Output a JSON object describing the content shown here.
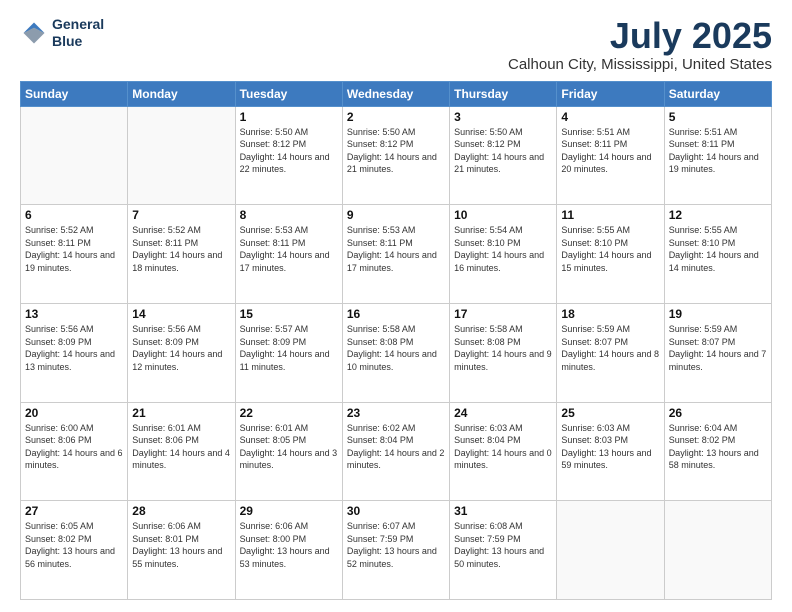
{
  "header": {
    "logo_line1": "General",
    "logo_line2": "Blue",
    "title": "July 2025",
    "subtitle": "Calhoun City, Mississippi, United States"
  },
  "weekdays": [
    "Sunday",
    "Monday",
    "Tuesday",
    "Wednesday",
    "Thursday",
    "Friday",
    "Saturday"
  ],
  "weeks": [
    [
      {
        "day": "",
        "info": ""
      },
      {
        "day": "",
        "info": ""
      },
      {
        "day": "1",
        "info": "Sunrise: 5:50 AM\nSunset: 8:12 PM\nDaylight: 14 hours\nand 22 minutes."
      },
      {
        "day": "2",
        "info": "Sunrise: 5:50 AM\nSunset: 8:12 PM\nDaylight: 14 hours\nand 21 minutes."
      },
      {
        "day": "3",
        "info": "Sunrise: 5:50 AM\nSunset: 8:12 PM\nDaylight: 14 hours\nand 21 minutes."
      },
      {
        "day": "4",
        "info": "Sunrise: 5:51 AM\nSunset: 8:11 PM\nDaylight: 14 hours\nand 20 minutes."
      },
      {
        "day": "5",
        "info": "Sunrise: 5:51 AM\nSunset: 8:11 PM\nDaylight: 14 hours\nand 19 minutes."
      }
    ],
    [
      {
        "day": "6",
        "info": "Sunrise: 5:52 AM\nSunset: 8:11 PM\nDaylight: 14 hours\nand 19 minutes."
      },
      {
        "day": "7",
        "info": "Sunrise: 5:52 AM\nSunset: 8:11 PM\nDaylight: 14 hours\nand 18 minutes."
      },
      {
        "day": "8",
        "info": "Sunrise: 5:53 AM\nSunset: 8:11 PM\nDaylight: 14 hours\nand 17 minutes."
      },
      {
        "day": "9",
        "info": "Sunrise: 5:53 AM\nSunset: 8:11 PM\nDaylight: 14 hours\nand 17 minutes."
      },
      {
        "day": "10",
        "info": "Sunrise: 5:54 AM\nSunset: 8:10 PM\nDaylight: 14 hours\nand 16 minutes."
      },
      {
        "day": "11",
        "info": "Sunrise: 5:55 AM\nSunset: 8:10 PM\nDaylight: 14 hours\nand 15 minutes."
      },
      {
        "day": "12",
        "info": "Sunrise: 5:55 AM\nSunset: 8:10 PM\nDaylight: 14 hours\nand 14 minutes."
      }
    ],
    [
      {
        "day": "13",
        "info": "Sunrise: 5:56 AM\nSunset: 8:09 PM\nDaylight: 14 hours\nand 13 minutes."
      },
      {
        "day": "14",
        "info": "Sunrise: 5:56 AM\nSunset: 8:09 PM\nDaylight: 14 hours\nand 12 minutes."
      },
      {
        "day": "15",
        "info": "Sunrise: 5:57 AM\nSunset: 8:09 PM\nDaylight: 14 hours\nand 11 minutes."
      },
      {
        "day": "16",
        "info": "Sunrise: 5:58 AM\nSunset: 8:08 PM\nDaylight: 14 hours\nand 10 minutes."
      },
      {
        "day": "17",
        "info": "Sunrise: 5:58 AM\nSunset: 8:08 PM\nDaylight: 14 hours\nand 9 minutes."
      },
      {
        "day": "18",
        "info": "Sunrise: 5:59 AM\nSunset: 8:07 PM\nDaylight: 14 hours\nand 8 minutes."
      },
      {
        "day": "19",
        "info": "Sunrise: 5:59 AM\nSunset: 8:07 PM\nDaylight: 14 hours\nand 7 minutes."
      }
    ],
    [
      {
        "day": "20",
        "info": "Sunrise: 6:00 AM\nSunset: 8:06 PM\nDaylight: 14 hours\nand 6 minutes."
      },
      {
        "day": "21",
        "info": "Sunrise: 6:01 AM\nSunset: 8:06 PM\nDaylight: 14 hours\nand 4 minutes."
      },
      {
        "day": "22",
        "info": "Sunrise: 6:01 AM\nSunset: 8:05 PM\nDaylight: 14 hours\nand 3 minutes."
      },
      {
        "day": "23",
        "info": "Sunrise: 6:02 AM\nSunset: 8:04 PM\nDaylight: 14 hours\nand 2 minutes."
      },
      {
        "day": "24",
        "info": "Sunrise: 6:03 AM\nSunset: 8:04 PM\nDaylight: 14 hours\nand 0 minutes."
      },
      {
        "day": "25",
        "info": "Sunrise: 6:03 AM\nSunset: 8:03 PM\nDaylight: 13 hours\nand 59 minutes."
      },
      {
        "day": "26",
        "info": "Sunrise: 6:04 AM\nSunset: 8:02 PM\nDaylight: 13 hours\nand 58 minutes."
      }
    ],
    [
      {
        "day": "27",
        "info": "Sunrise: 6:05 AM\nSunset: 8:02 PM\nDaylight: 13 hours\nand 56 minutes."
      },
      {
        "day": "28",
        "info": "Sunrise: 6:06 AM\nSunset: 8:01 PM\nDaylight: 13 hours\nand 55 minutes."
      },
      {
        "day": "29",
        "info": "Sunrise: 6:06 AM\nSunset: 8:00 PM\nDaylight: 13 hours\nand 53 minutes."
      },
      {
        "day": "30",
        "info": "Sunrise: 6:07 AM\nSunset: 7:59 PM\nDaylight: 13 hours\nand 52 minutes."
      },
      {
        "day": "31",
        "info": "Sunrise: 6:08 AM\nSunset: 7:59 PM\nDaylight: 13 hours\nand 50 minutes."
      },
      {
        "day": "",
        "info": ""
      },
      {
        "day": "",
        "info": ""
      }
    ]
  ]
}
